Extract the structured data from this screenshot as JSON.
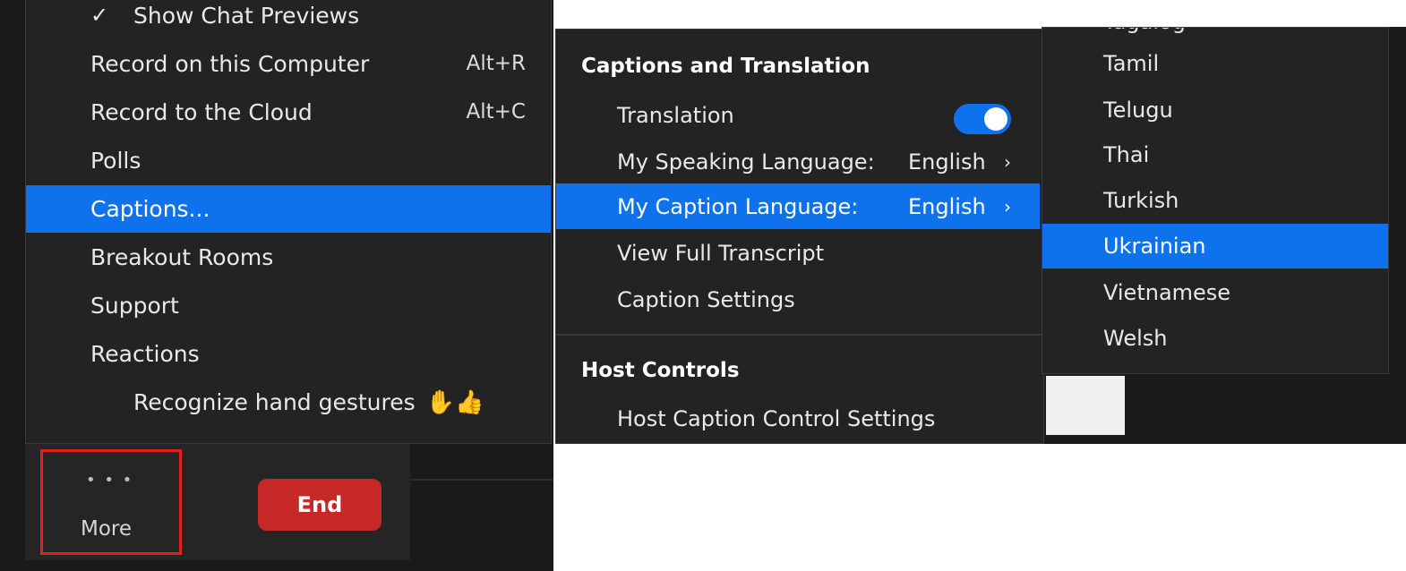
{
  "more_menu": {
    "items": [
      {
        "label": "Show Chat Previews",
        "checked": true,
        "shortcut": ""
      },
      {
        "label": "Record on this Computer",
        "shortcut": "Alt+R"
      },
      {
        "label": "Record to the Cloud",
        "shortcut": "Alt+C"
      },
      {
        "label": "Polls",
        "shortcut": ""
      },
      {
        "label": "Captions...",
        "shortcut": "",
        "selected": true
      },
      {
        "label": "Breakout Rooms",
        "shortcut": ""
      },
      {
        "label": "Support",
        "shortcut": ""
      },
      {
        "label": "Reactions",
        "shortcut": ""
      },
      {
        "label": "Recognize hand gestures",
        "shortcut": "",
        "emoji": "✋👍"
      }
    ]
  },
  "toolbar": {
    "more_dots": "• • •",
    "more_label": "More",
    "end_label": "End",
    "end_color": "#c62828",
    "highlight_color": "#e01f1f"
  },
  "captions_menu": {
    "section1_title": "Captions and Translation",
    "translation_label": "Translation",
    "translation_enabled": true,
    "speaking_label": "My Speaking Language:",
    "speaking_value": "English",
    "caption_label": "My Caption Language:",
    "caption_value": "English",
    "view_transcript": "View Full Transcript",
    "caption_settings": "Caption Settings",
    "section2_title": "Host Controls",
    "host_caption_settings": "Host Caption Control Settings",
    "chevron": "›"
  },
  "language_menu": {
    "partial_top": "Tagalog",
    "items": [
      "Tamil",
      "Telugu",
      "Thai",
      "Turkish",
      "Ukrainian",
      "Vietnamese",
      "Welsh"
    ],
    "selected": "Ukrainian"
  },
  "colors": {
    "accent": "#0e72ed",
    "menu_bg": "#232323"
  }
}
